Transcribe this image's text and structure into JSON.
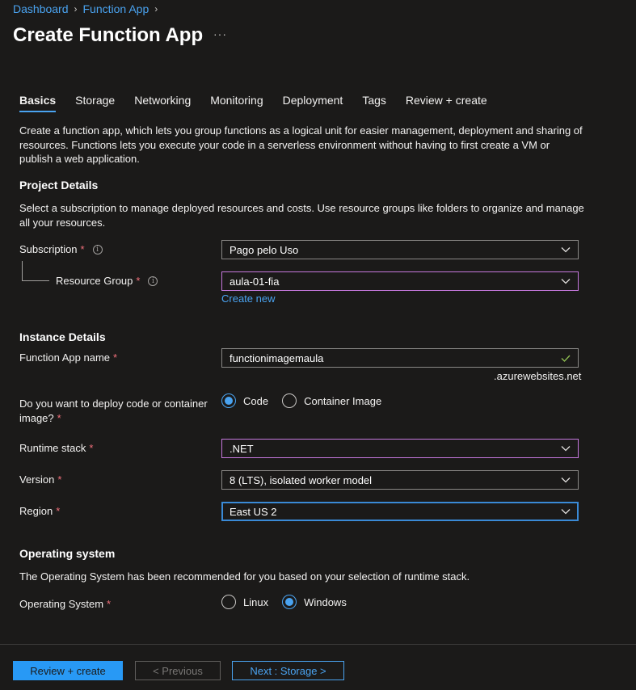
{
  "breadcrumb": {
    "items": [
      "Dashboard",
      "Function App"
    ]
  },
  "page_title": "Create Function App",
  "more_label": "···",
  "tabs": [
    {
      "label": "Basics",
      "active": true
    },
    {
      "label": "Storage"
    },
    {
      "label": "Networking"
    },
    {
      "label": "Monitoring"
    },
    {
      "label": "Deployment"
    },
    {
      "label": "Tags"
    },
    {
      "label": "Review + create"
    }
  ],
  "intro": "Create a function app, which lets you group functions as a logical unit for easier management, deployment and sharing of resources. Functions lets you execute your code in a serverless environment without having to first create a VM or publish a web application.",
  "project": {
    "title": "Project Details",
    "description": "Select a subscription to manage deployed resources and costs. Use resource groups like folders to organize and manage all your resources.",
    "subscription_label": "Subscription",
    "subscription_value": "Pago pelo Uso",
    "resource_group_label": "Resource Group",
    "resource_group_value": "aula-01-fia",
    "create_new": "Create new"
  },
  "instance": {
    "title": "Instance Details",
    "name_label": "Function App name",
    "name_value": "functionimagemaula",
    "name_suffix": ".azurewebsites.net",
    "deploy_label": "Do you want to deploy code or container image?",
    "deploy_options": [
      "Code",
      "Container Image"
    ],
    "deploy_selected": "Code",
    "runtime_label": "Runtime stack",
    "runtime_value": ".NET",
    "version_label": "Version",
    "version_value": "8 (LTS), isolated worker model",
    "region_label": "Region",
    "region_value": "East US 2"
  },
  "os": {
    "title": "Operating system",
    "description": "The Operating System has been recommended for you based on your selection of runtime stack.",
    "label": "Operating System",
    "options": [
      "Linux",
      "Windows"
    ],
    "selected": "Windows"
  },
  "footer": {
    "review_create": "Review + create",
    "previous": "< Previous",
    "next": "Next : Storage >"
  },
  "colors": {
    "background": "#1b1a19",
    "accent": "#4aa3f0",
    "required": "#f1707b",
    "primary_button": "#2899f5",
    "valid_check": "#92c353"
  }
}
